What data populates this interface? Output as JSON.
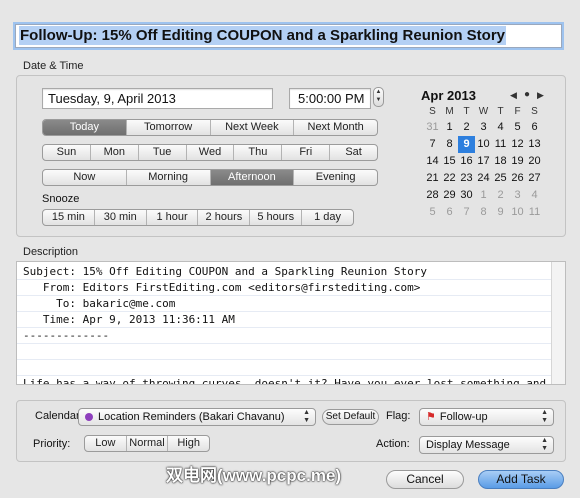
{
  "title": {
    "value": "Follow-Up: 15% Off Editing COUPON and a Sparkling Reunion Story"
  },
  "date_time": {
    "label": "Date & Time",
    "date_value": "Tuesday, 9, April 2013",
    "time_value": "5:00:00 PM",
    "quick_days": [
      "Today",
      "Tomorrow",
      "Next Week",
      "Next Month"
    ],
    "quick_days_selected": "Today",
    "weekdays": [
      "Sun",
      "Mon",
      "Tue",
      "Wed",
      "Thu",
      "Fri",
      "Sat"
    ],
    "times_of_day": [
      "Now",
      "Morning",
      "Afternoon",
      "Evening"
    ],
    "times_of_day_selected": "Afternoon",
    "snooze_label": "Snooze",
    "snooze_options": [
      "15 min",
      "30 min",
      "1 hour",
      "2 hours",
      "5 hours",
      "1 day"
    ]
  },
  "calendar": {
    "month_label": "Apr 2013",
    "day_headers": [
      "S",
      "M",
      "T",
      "W",
      "T",
      "F",
      "S"
    ],
    "weeks": [
      [
        {
          "d": "31",
          "dim": true
        },
        {
          "d": "1"
        },
        {
          "d": "2"
        },
        {
          "d": "3"
        },
        {
          "d": "4"
        },
        {
          "d": "5"
        },
        {
          "d": "6"
        }
      ],
      [
        {
          "d": "7"
        },
        {
          "d": "8"
        },
        {
          "d": "9",
          "sel": true
        },
        {
          "d": "10"
        },
        {
          "d": "11"
        },
        {
          "d": "12"
        },
        {
          "d": "13"
        }
      ],
      [
        {
          "d": "14"
        },
        {
          "d": "15"
        },
        {
          "d": "16"
        },
        {
          "d": "17"
        },
        {
          "d": "18"
        },
        {
          "d": "19"
        },
        {
          "d": "20"
        }
      ],
      [
        {
          "d": "21"
        },
        {
          "d": "22"
        },
        {
          "d": "23"
        },
        {
          "d": "24"
        },
        {
          "d": "25"
        },
        {
          "d": "26"
        },
        {
          "d": "27"
        }
      ],
      [
        {
          "d": "28"
        },
        {
          "d": "29"
        },
        {
          "d": "30"
        },
        {
          "d": "1",
          "dim": true
        },
        {
          "d": "2",
          "dim": true
        },
        {
          "d": "3",
          "dim": true
        },
        {
          "d": "4",
          "dim": true
        }
      ],
      [
        {
          "d": "5",
          "dim": true
        },
        {
          "d": "6",
          "dim": true
        },
        {
          "d": "7",
          "dim": true
        },
        {
          "d": "8",
          "dim": true
        },
        {
          "d": "9",
          "dim": true
        },
        {
          "d": "10",
          "dim": true
        },
        {
          "d": "11",
          "dim": true
        }
      ]
    ]
  },
  "description": {
    "label": "Description",
    "lines": [
      "Subject: 15% Off Editing COUPON and a Sparkling Reunion Story",
      "   From: Editors FirstEditing.com <editors@firstediting.com>",
      "     To: bakaric@me.com",
      "   Time: Apr 9, 2013 11:36:11 AM",
      "-------------",
      "",
      "",
      "Life has a way of throwing curves, doesn't it? Have you ever lost something and"
    ]
  },
  "options": {
    "calendar_label": "Calendar:",
    "calendar_value": "Location Reminders (Bakari Chavanu)",
    "calendar_color": "#8e3fbd",
    "set_default_label": "Set Default",
    "flag_label": "Flag:",
    "flag_value": "Follow-up",
    "flag_color": "#d62a2a",
    "priority_label": "Priority:",
    "priority_options": [
      "Low",
      "Normal",
      "High"
    ],
    "action_label": "Action:",
    "action_value": "Display Message"
  },
  "footer": {
    "watermark": "双电网(www.pcpc.me)",
    "cancel_label": "Cancel",
    "add_task_label": "Add Task"
  }
}
